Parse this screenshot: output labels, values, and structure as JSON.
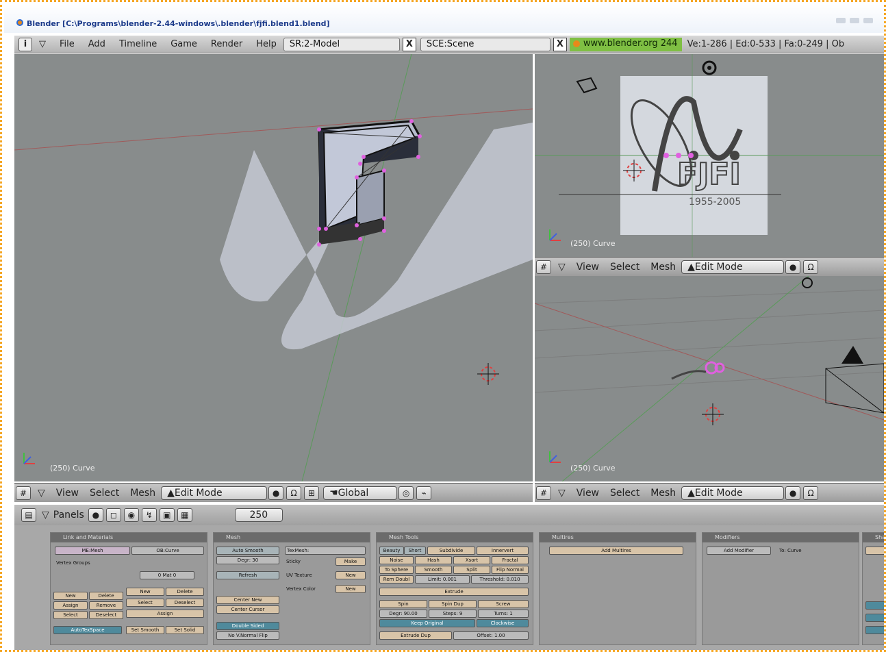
{
  "window": {
    "title": "Blender [C:\\Programs\\blender-2.44-windows\\.blender\\fjfi.blend1.blend]"
  },
  "topbar": {
    "info_icon": "i",
    "menus": [
      "File",
      "Add",
      "Timeline",
      "Game",
      "Render",
      "Help"
    ],
    "screen_field": "SR:2-Model",
    "scene_field": "SCE:Scene",
    "close_label": "X",
    "web_link": "www.blender.org 244",
    "stats": "Ve:1-286 | Ed:0-533 | Fa:0-249 | Ob"
  },
  "viewports": {
    "main_label": "(250) Curve",
    "top_right_label": "(250) Curve",
    "bottom_right_label": "(250) Curve",
    "logo_text": "FJFI",
    "logo_years": "1955-2005"
  },
  "view_header": {
    "menus": [
      "View",
      "Select",
      "Mesh"
    ],
    "mode": "Edit Mode",
    "orientation": "Global"
  },
  "buttons_window": {
    "panels_label": "Panels",
    "frame": "250",
    "panel_titles": [
      "Link and Materials",
      "Mesh",
      "Mesh Tools",
      "Multires",
      "Modifiers",
      "Shapes"
    ],
    "link": {
      "me_field": "ME:Mesh",
      "ob_field": "OB:Curve",
      "vertex_groups": "Vertex Groups",
      "mat_field": "0 Mat 0",
      "buttons": [
        "New",
        "Delete",
        "Assign",
        "Remove",
        "Select",
        "Deselect",
        "New",
        "Delete",
        "Select",
        "Deselect",
        "Assign",
        "AutoTexSpace",
        "Set Smooth",
        "Set Solid"
      ]
    },
    "mesh": {
      "auto_smooth": "Auto Smooth",
      "degr": "Degr: 30",
      "refresh": "Refresh",
      "texmesh": "TexMesh:",
      "sticky": "Sticky",
      "uv_texture": "UV Texture",
      "vertex_color": "Vertex Color",
      "make": "Make",
      "new1": "New",
      "new2": "New",
      "center_new": "Center New",
      "center_cursor": "Center Cursor",
      "double_sided": "Double Sided",
      "no_vnormal": "No V.Normal Flip"
    },
    "tools": {
      "row1": [
        "Beauty",
        "Short",
        "Subdivide",
        "Innervert"
      ],
      "row2": [
        "Noise",
        "Hash",
        "Xsort",
        "Fractal"
      ],
      "row3": [
        "To Sphere",
        "Smooth",
        "Split",
        "Flip Normal"
      ],
      "row4": [
        "Rem Doubl",
        "Limit: 0.001",
        "Threshold: 0.010"
      ],
      "extrude": "Extrude",
      "row6": [
        "Spin",
        "Spin Dup",
        "Screw"
      ],
      "row7": [
        "Degr: 90.00",
        "Steps: 9",
        "Turns: 1"
      ],
      "keep_original": "Keep Original",
      "clockwise": "Clockwise",
      "extrude_dup": "Extrude Dup",
      "offset": "Offset: 1.00"
    },
    "multires": {
      "add": "Add Multires"
    },
    "modifiers": {
      "add": "Add Modifier",
      "to": "To: Curve"
    }
  }
}
